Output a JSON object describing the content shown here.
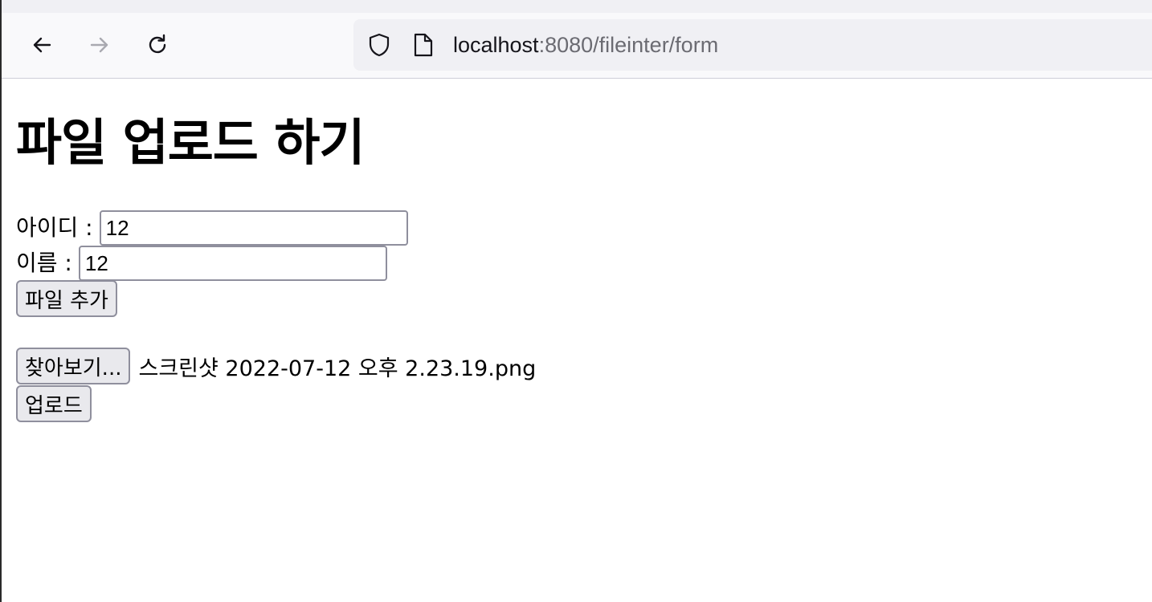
{
  "browser": {
    "url_host": "localhost",
    "url_rest": ":8080/fileinter/form"
  },
  "page": {
    "heading": "파일 업로드 하기",
    "id_label": "아이디 :",
    "id_value": "12",
    "name_label": "이름 :",
    "name_value": "12",
    "add_file_label": "파일 추가",
    "browse_label": "찾아보기...",
    "file_name": "스크린샷 2022-07-12 오후 2.23.19.png",
    "upload_label": "업로드"
  },
  "icons": {
    "back": "arrow-left-icon",
    "forward": "arrow-right-icon",
    "reload": "reload-icon",
    "shield": "shield-icon",
    "page": "page-icon"
  }
}
